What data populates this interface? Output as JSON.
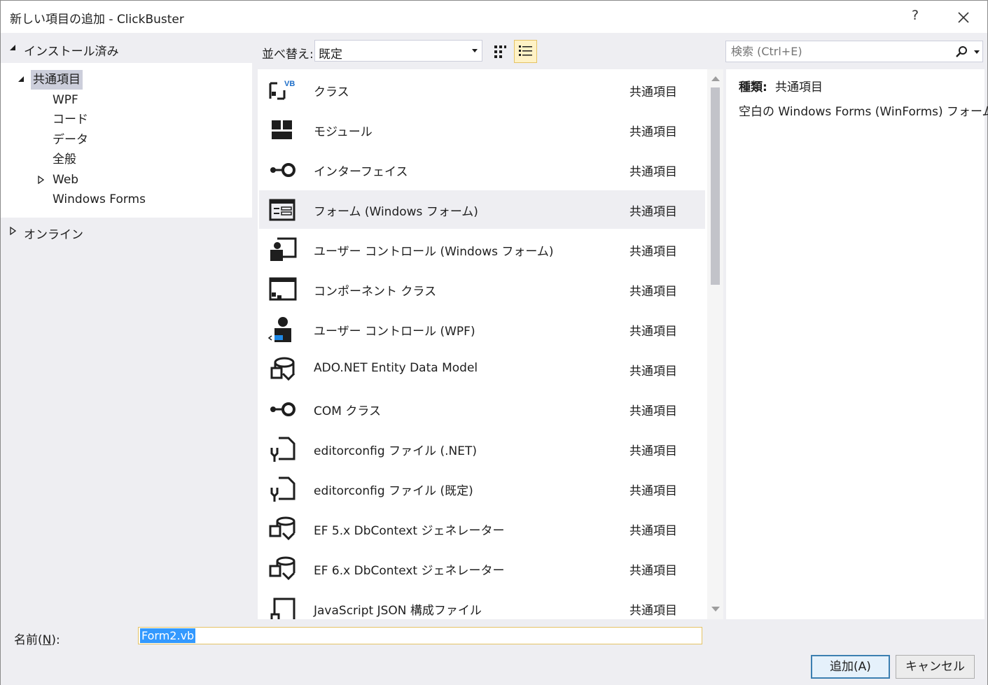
{
  "window": {
    "title": "新しい項目の追加 - ClickBuster",
    "help_label": "?"
  },
  "left": {
    "installed_label": "インストール済み",
    "tree": [
      {
        "label": "共通項目"
      },
      {
        "label": "WPF"
      },
      {
        "label": "コード"
      },
      {
        "label": "データ"
      },
      {
        "label": "全般"
      },
      {
        "label": "Web"
      },
      {
        "label": "Windows Forms"
      }
    ],
    "online_label": "オンライン"
  },
  "toolbar": {
    "sort_label": "並べ替え:",
    "sort_value": "既定",
    "search_placeholder": "検索 (Ctrl+E)"
  },
  "templates": [
    {
      "name": "クラス",
      "category": "共通項目",
      "icon": "class-icon"
    },
    {
      "name": "モジュール",
      "category": "共通項目",
      "icon": "module-icon"
    },
    {
      "name": "インターフェイス",
      "category": "共通項目",
      "icon": "interface-icon"
    },
    {
      "name": "フォーム (Windows フォーム)",
      "category": "共通項目",
      "icon": "form-icon"
    },
    {
      "name": "ユーザー コントロール (Windows フォーム)",
      "category": "共通項目",
      "icon": "user-control-icon"
    },
    {
      "name": "コンポーネント クラス",
      "category": "共通項目",
      "icon": "component-icon"
    },
    {
      "name": "ユーザー コントロール (WPF)",
      "category": "共通項目",
      "icon": "wpf-user-control-icon"
    },
    {
      "name": "ADO.NET Entity Data Model",
      "category": "共通項目",
      "icon": "entity-model-icon"
    },
    {
      "name": "COM クラス",
      "category": "共通項目",
      "icon": "com-class-icon"
    },
    {
      "name": "editorconfig ファイル (.NET)",
      "category": "共通項目",
      "icon": "config-file-icon"
    },
    {
      "name": "editorconfig ファイル (既定)",
      "category": "共通項目",
      "icon": "config-file-icon"
    },
    {
      "name": "EF 5.x DbContext ジェネレーター",
      "category": "共通項目",
      "icon": "generator-icon"
    },
    {
      "name": "EF 6.x DbContext ジェネレーター",
      "category": "共通項目",
      "icon": "generator-icon"
    },
    {
      "name": "JavaScript JSON 構成ファイル",
      "category": "共通項目",
      "icon": "json-config-icon"
    }
  ],
  "details": {
    "type_label": "種類:",
    "type_value": "共通項目",
    "description": "空白の Windows Forms (WinForms) フォーム"
  },
  "bottom": {
    "name_label_prefix": "名前(",
    "name_label_key": "N",
    "name_label_suffix": "):",
    "name_value": "Form2.vb",
    "add_button": "追加(A)",
    "cancel_button": "キャンセル"
  },
  "colors": {
    "selection": "#cccedb",
    "accent_blue": "#3399ff",
    "focus_border": "#e5c365"
  }
}
